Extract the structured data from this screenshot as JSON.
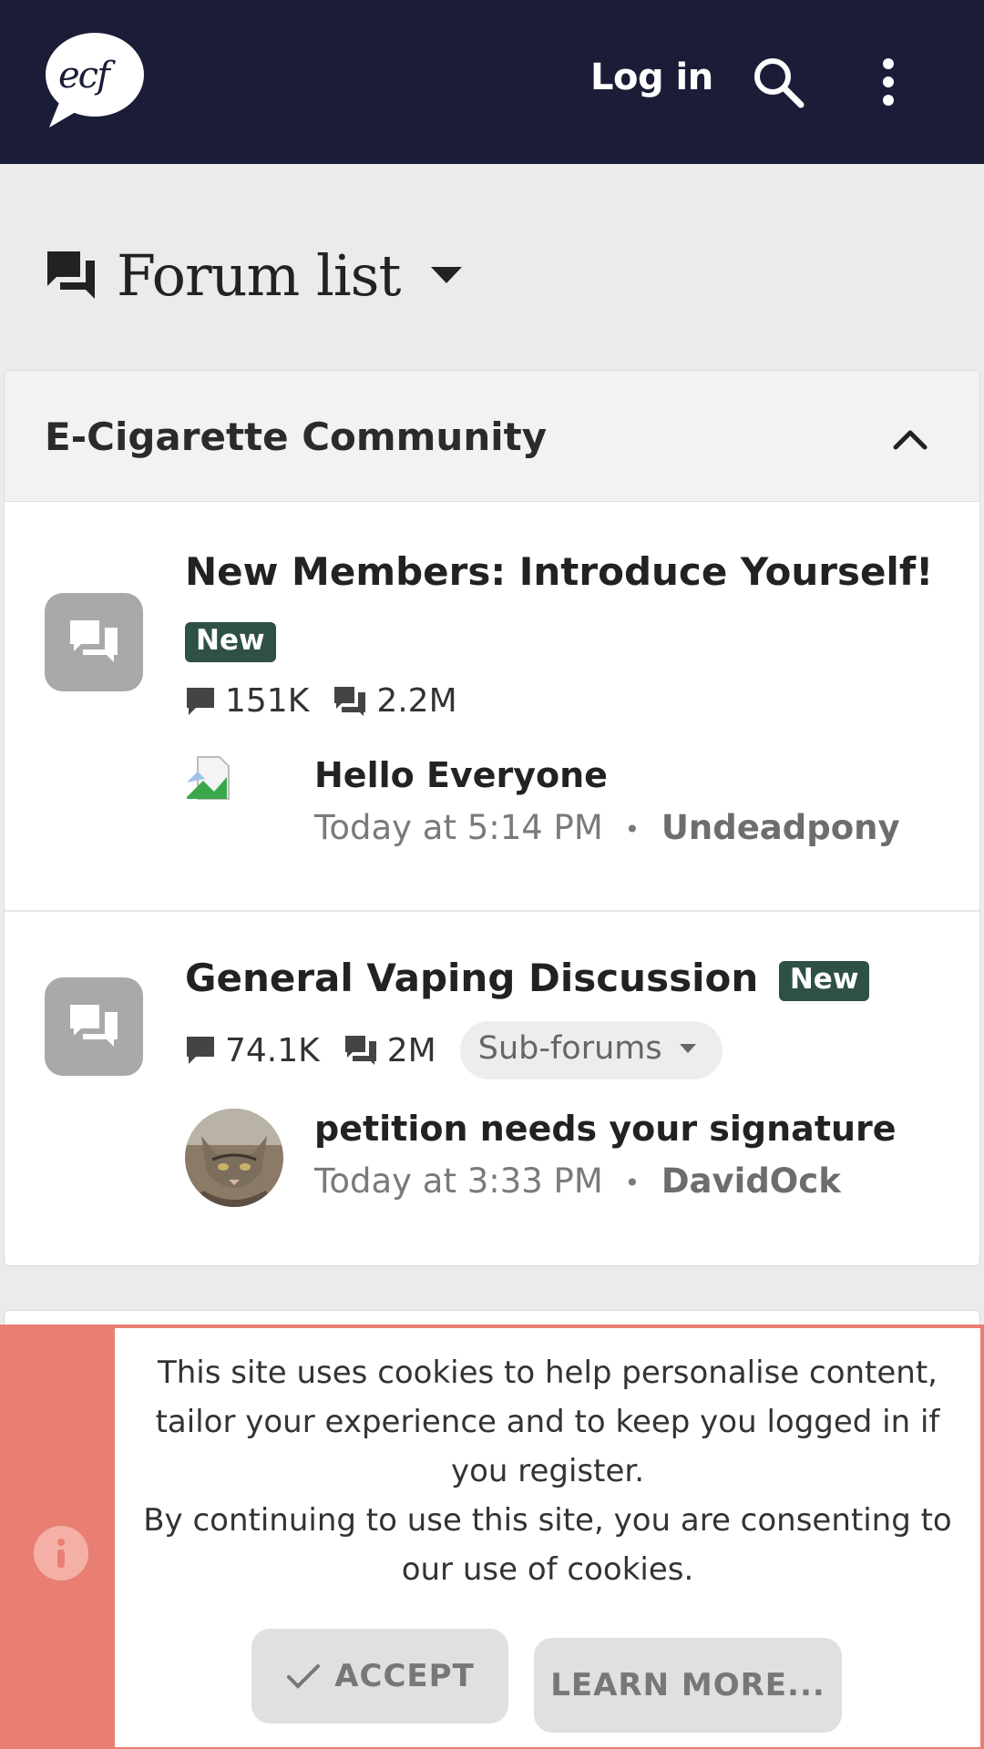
{
  "header": {
    "logo_text": "ecf",
    "login_label": "Log in",
    "icons": [
      "search-icon",
      "more-vertical-icon"
    ],
    "bg_color": "#1a1c38"
  },
  "page": {
    "title": "Forum list",
    "title_icon": "forum-icon"
  },
  "category": {
    "title": "E-Cigarette Community",
    "collapse_icon": "chevron-up-icon",
    "nodes": [
      {
        "title": "New Members: Introduce Yourself!",
        "badge": "New",
        "threads": "151K",
        "messages": "2.2M",
        "last_post": {
          "title": "Hello Everyone",
          "time": "Today at 5:14 PM",
          "separator": "•",
          "user": "Undeadpony"
        }
      },
      {
        "title": "General Vaping Discussion",
        "badge": "New",
        "threads": "74.1K",
        "messages": "2M",
        "subforums_label": "Sub-forums",
        "last_post": {
          "title": "petition needs your signature",
          "time": "Today at 3:33 PM",
          "separator": "•",
          "user": "DavidOck"
        }
      }
    ]
  },
  "cookie": {
    "line1": "This site uses cookies to help personalise content, tailor your experience and to keep you logged in if you register.",
    "line2": "By continuing to use this site, you are consenting to our use of cookies.",
    "accept_label": "ACCEPT",
    "learn_more_label": "LEARN MORE...",
    "bg_color": "#e87f72",
    "badge_color": "#2e5045"
  }
}
